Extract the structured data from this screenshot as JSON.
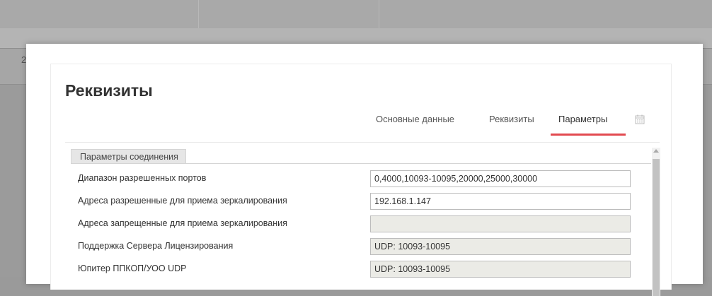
{
  "background": {
    "row_number": "2"
  },
  "modal": {
    "title": "Реквизиты",
    "tabs": [
      {
        "label": "Основные данные",
        "active": false
      },
      {
        "label": "Реквизиты",
        "active": false
      },
      {
        "label": "Параметры",
        "active": true
      }
    ],
    "calendar_icon": "calendar-icon",
    "accent_color": "#e24a50",
    "section": {
      "legend": "Параметры соединения",
      "fields": [
        {
          "label": "Диапазон разрешенных портов",
          "value": "0,4000,10093-10095,20000,25000,30000",
          "readonly": false
        },
        {
          "label": "Адреса разрешенные для приема зеркалирования",
          "value": "192.168.1.147",
          "readonly": false
        },
        {
          "label": "Адреса запрещенные для приема зеркалирования",
          "value": "",
          "readonly": true
        },
        {
          "label": "Поддержка Сервера Лицензирования",
          "value": "UDP: 10093-10095",
          "readonly": true
        },
        {
          "label": "Юпитер ППКОП/УОО UDP",
          "value": "UDP: 10093-10095",
          "readonly": true
        }
      ]
    }
  }
}
